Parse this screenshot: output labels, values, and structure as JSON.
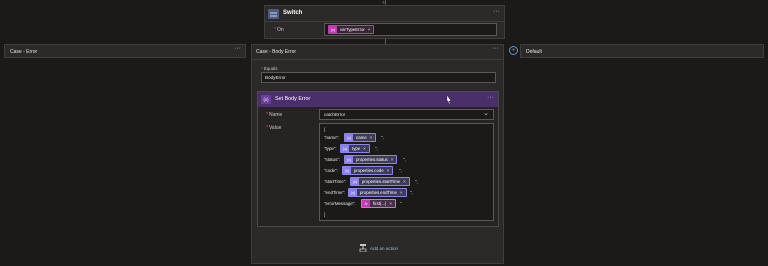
{
  "switch": {
    "title": "Switch",
    "on_label": "On",
    "on_token": "varTypeError",
    "on_token_icon": "{x}"
  },
  "case_left": {
    "title": "Case - Error"
  },
  "case_body": {
    "title": "Case - Body Error",
    "equals_label": "Equals",
    "equals_value": "BodyError"
  },
  "default_case": {
    "title": "Default",
    "add_icon": "+"
  },
  "set_var": {
    "title": "Set Body Error",
    "icon": "{x}",
    "name_label": "Name",
    "name_value": "catchError",
    "value_label": "Value",
    "open_brace": "{",
    "close_brace": "}",
    "rows": [
      {
        "key": "\"name\":",
        "token": "name",
        "icon": "{x}",
        "trail": "\","
      },
      {
        "key": "\"type\":",
        "token": "type",
        "icon": "{x}",
        "trail": "\","
      },
      {
        "key": "\"status\":",
        "token": "properties.status",
        "icon": "{x}",
        "trail": "\","
      },
      {
        "key": "\"code\":",
        "token": "properties.code",
        "icon": "{x}",
        "trail": "\","
      },
      {
        "key": "\"startTime\":",
        "token": "properties.startTime",
        "icon": "{x}",
        "trail": "\","
      },
      {
        "key": "\"endTime\":",
        "token": "properties.endTime",
        "icon": "{x}",
        "trail": "\","
      },
      {
        "key": "\"errorMessage\":",
        "token": "first(...)",
        "icon": "fx",
        "trail": "\""
      }
    ]
  },
  "add_action": {
    "label": "Add an action"
  },
  "glyphs": {
    "more": "···",
    "close": "×",
    "chevron": "⌄",
    "required": "*"
  },
  "colors": {
    "token_var": "#8a7df0",
    "token_fx": "#c239b3",
    "header_purple": "#4b2f6b"
  }
}
